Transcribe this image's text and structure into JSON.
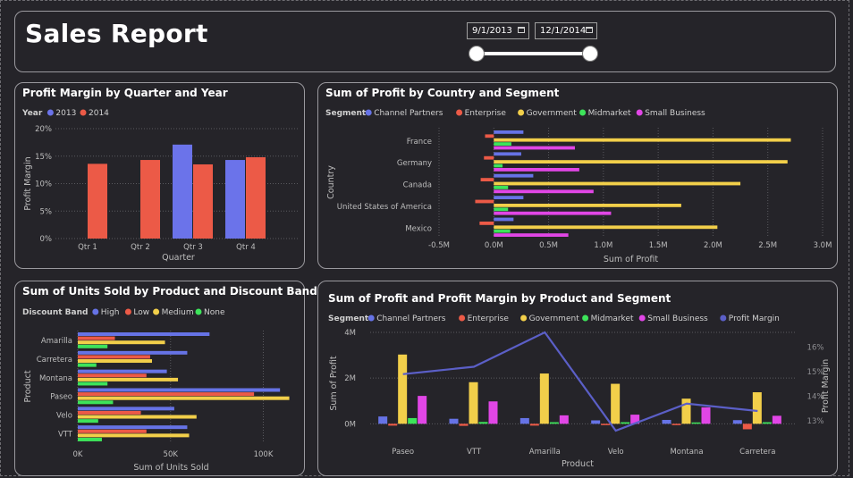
{
  "report": {
    "title": "Sales Report"
  },
  "date_filter": {
    "start": "9/1/2013",
    "end": "12/1/2014"
  },
  "colors": {
    "y2013": "#6b73ea",
    "y2014": "#ec5a47",
    "channel_partners": "#6673e6",
    "enterprise": "#ec5a47",
    "government": "#f2cf4a",
    "midmarket": "#3de35a",
    "small_business": "#e146e6",
    "profit_margin": "#5b5fc7",
    "high": "#6673e6",
    "low": "#ec5a47",
    "medium": "#f2cf4a",
    "none": "#3de35a",
    "grid": "#5a5a5f",
    "axis_text": "#bdbdbd"
  },
  "chart_data": [
    {
      "id": "margin_by_quarter",
      "type": "bar",
      "title": "Profit Margin by Quarter and Year",
      "legend_title": "Year",
      "legend_position": "top-left",
      "xlabel": "Quarter",
      "ylabel": "Profit Margin",
      "categories": [
        "Qtr 1",
        "Qtr 2",
        "Qtr 3",
        "Qtr 4"
      ],
      "series": [
        {
          "name": "2013",
          "color_key": "y2013",
          "values": [
            null,
            null,
            17.1,
            14.3
          ]
        },
        {
          "name": "2014",
          "color_key": "y2014",
          "values": [
            13.6,
            14.3,
            13.5,
            14.8
          ]
        }
      ],
      "ylim": [
        0,
        20
      ],
      "yticks": [
        "0%",
        "5%",
        "10%",
        "15%",
        "20%"
      ],
      "grid": true
    },
    {
      "id": "profit_by_country_segment",
      "type": "bar",
      "orientation": "horizontal",
      "title": "Sum of Profit by Country and Segment",
      "legend_title": "Segment",
      "legend_position": "top-left",
      "xlabel": "Sum of Profit",
      "ylabel": "Country",
      "categories": [
        "France",
        "Germany",
        "Canada",
        "United States of America",
        "Mexico"
      ],
      "series": [
        {
          "name": "Channel Partners",
          "color_key": "channel_partners",
          "values": [
            0.27,
            0.25,
            0.36,
            0.27,
            0.18
          ]
        },
        {
          "name": "Enterprise",
          "color_key": "enterprise",
          "values": [
            -0.08,
            -0.09,
            -0.12,
            -0.17,
            -0.13
          ]
        },
        {
          "name": "Government",
          "color_key": "government",
          "values": [
            2.71,
            2.68,
            2.25,
            1.71,
            2.04
          ]
        },
        {
          "name": "Midmarket",
          "color_key": "midmarket",
          "values": [
            0.16,
            0.08,
            0.13,
            0.13,
            0.15
          ]
        },
        {
          "name": "Small Business",
          "color_key": "small_business",
          "values": [
            0.74,
            0.78,
            0.91,
            1.07,
            0.68
          ]
        }
      ],
      "xlim": [
        -0.5,
        3.0
      ],
      "xticks": [
        "-0.5M",
        "0.0M",
        "0.5M",
        "1.0M",
        "1.5M",
        "2.0M",
        "2.5M",
        "3.0M"
      ],
      "grid": true
    },
    {
      "id": "units_by_product_band",
      "type": "bar",
      "orientation": "horizontal",
      "title": "Sum of Units Sold by Product and Discount Band",
      "legend_title": "Discount Band",
      "legend_position": "top-left",
      "xlabel": "Sum of Units Sold",
      "ylabel": "Product",
      "categories": [
        "Amarilla",
        "Carretera",
        "Montana",
        "Paseo",
        "Velo",
        "VTT"
      ],
      "series": [
        {
          "name": "High",
          "color_key": "high",
          "values": [
            71000,
            59000,
            48000,
            109000,
            52000,
            59000
          ]
        },
        {
          "name": "Low",
          "color_key": "low",
          "values": [
            20000,
            39000,
            37000,
            95000,
            34000,
            37000
          ]
        },
        {
          "name": "Medium",
          "color_key": "medium",
          "values": [
            47000,
            40000,
            54000,
            114000,
            64000,
            60000
          ]
        },
        {
          "name": "None",
          "color_key": "none",
          "values": [
            16000,
            10000,
            16000,
            19000,
            11000,
            13000
          ]
        }
      ],
      "xlim": [
        0,
        120000
      ],
      "xticks": [
        "0K",
        "50K",
        "100K"
      ],
      "grid": true
    },
    {
      "id": "profit_margin_by_product_segment",
      "type": "bar",
      "title": "Sum of Profit and Profit Margin by Product and Segment",
      "legend_title": "Segment",
      "legend_position": "top-left",
      "xlabel": "Product",
      "ylabel": "Sum of Profit",
      "y2label": "Profit Margin",
      "categories": [
        "Paseo",
        "VTT",
        "Amarilla",
        "Velo",
        "Montana",
        "Carretera"
      ],
      "series": [
        {
          "name": "Channel Partners",
          "color_key": "channel_partners",
          "values": [
            0.32,
            0.22,
            0.25,
            0.15,
            0.17,
            0.16
          ]
        },
        {
          "name": "Enterprise",
          "color_key": "enterprise",
          "values": [
            -0.08,
            -0.09,
            -0.08,
            -0.06,
            -0.06,
            -0.24
          ]
        },
        {
          "name": "Government",
          "color_key": "government",
          "values": [
            3.03,
            1.82,
            2.2,
            1.75,
            1.1,
            1.38
          ]
        },
        {
          "name": "Midmarket",
          "color_key": "midmarket",
          "values": [
            0.25,
            0.08,
            0.07,
            0.07,
            0.06,
            0.07
          ]
        },
        {
          "name": "Small Business",
          "color_key": "small_business",
          "values": [
            1.22,
            0.98,
            0.37,
            0.4,
            0.72,
            0.35
          ]
        }
      ],
      "line_series": {
        "name": "Profit Margin",
        "color_key": "profit_margin",
        "values": [
          14.9,
          15.2,
          16.6,
          12.6,
          13.7,
          13.4
        ]
      },
      "ylim": [
        -0.3,
        4
      ],
      "yticks": [
        "0M",
        "2M",
        "4M"
      ],
      "y2lim": [
        12.6,
        16.6
      ],
      "y2ticks": [
        "13%",
        "14%",
        "15%",
        "16%"
      ],
      "grid": true
    }
  ]
}
